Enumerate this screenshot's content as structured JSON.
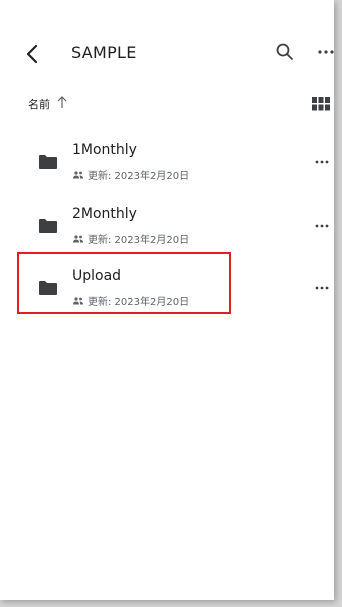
{
  "header": {
    "title": "SAMPLE"
  },
  "sort": {
    "label": "名前"
  },
  "files": [
    {
      "name": "1Monthly",
      "meta": "更新: 2023年2月20日"
    },
    {
      "name": "2Monthly",
      "meta": "更新: 2023年2月20日"
    },
    {
      "name": "Upload",
      "meta": "更新: 2023年2月20日"
    }
  ],
  "icons": {
    "back": "chevron-left-icon",
    "search": "search-icon",
    "more": "more-horizontal-icon",
    "sort_arrow": "arrow-up-icon",
    "grid": "grid-view-icon",
    "folder": "folder-icon",
    "shared": "shared-people-icon"
  },
  "colors": {
    "highlight": "#e02020",
    "text_primary": "#202124",
    "text_secondary": "#5f6368",
    "icon": "#3c4043"
  }
}
